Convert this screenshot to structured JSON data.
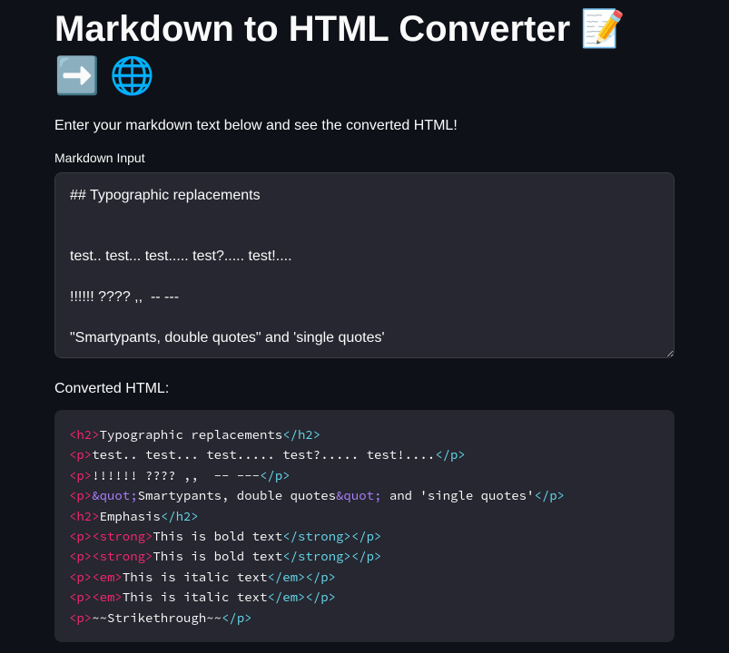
{
  "title": "Markdown to HTML Converter 📝 ➡️ 🌐",
  "intro": "Enter your markdown text below and see the converted HTML!",
  "input_label": "Markdown Input",
  "textarea_value": "## Typographic replacements\n\n\ntest.. test... test..... test?..... test!....\n\n!!!!!! ???? ,,  -- ---\n\n\"Smartypants, double quotes\" and 'single quotes'",
  "output_label": "Converted HTML:",
  "code_output": {
    "lines": [
      [
        {
          "type": "open",
          "text": "<h2>"
        },
        {
          "type": "text",
          "text": "Typographic replacements"
        },
        {
          "type": "close",
          "text": "</h2>"
        }
      ],
      [
        {
          "type": "open",
          "text": "<p>"
        },
        {
          "type": "text",
          "text": "test.. test... test..... test?..... test!...."
        },
        {
          "type": "close",
          "text": "</p>"
        }
      ],
      [
        {
          "type": "open",
          "text": "<p>"
        },
        {
          "type": "text",
          "text": "!!!!!! ???? ,,  -- ---"
        },
        {
          "type": "close",
          "text": "</p>"
        }
      ],
      [
        {
          "type": "open",
          "text": "<p>"
        },
        {
          "type": "entity",
          "text": "&quot;"
        },
        {
          "type": "text",
          "text": "Smartypants, double quotes"
        },
        {
          "type": "entity",
          "text": "&quot;"
        },
        {
          "type": "text",
          "text": " and 'single quotes'"
        },
        {
          "type": "close",
          "text": "</p>"
        }
      ],
      [
        {
          "type": "open",
          "text": "<h2>"
        },
        {
          "type": "text",
          "text": "Emphasis"
        },
        {
          "type": "close",
          "text": "</h2>"
        }
      ],
      [
        {
          "type": "open",
          "text": "<p>"
        },
        {
          "type": "open",
          "text": "<strong>"
        },
        {
          "type": "text",
          "text": "This is bold text"
        },
        {
          "type": "close",
          "text": "</strong>"
        },
        {
          "type": "close",
          "text": "</p>"
        }
      ],
      [
        {
          "type": "open",
          "text": "<p>"
        },
        {
          "type": "open",
          "text": "<strong>"
        },
        {
          "type": "text",
          "text": "This is bold text"
        },
        {
          "type": "close",
          "text": "</strong>"
        },
        {
          "type": "close",
          "text": "</p>"
        }
      ],
      [
        {
          "type": "open",
          "text": "<p>"
        },
        {
          "type": "open",
          "text": "<em>"
        },
        {
          "type": "text",
          "text": "This is italic text"
        },
        {
          "type": "close",
          "text": "</em>"
        },
        {
          "type": "close",
          "text": "</p>"
        }
      ],
      [
        {
          "type": "open",
          "text": "<p>"
        },
        {
          "type": "open",
          "text": "<em>"
        },
        {
          "type": "text",
          "text": "This is italic text"
        },
        {
          "type": "close",
          "text": "</em>"
        },
        {
          "type": "close",
          "text": "</p>"
        }
      ],
      [
        {
          "type": "open",
          "text": "<p>"
        },
        {
          "type": "text",
          "text": "~~Strikethrough~~"
        },
        {
          "type": "close",
          "text": "</p>"
        }
      ]
    ]
  }
}
